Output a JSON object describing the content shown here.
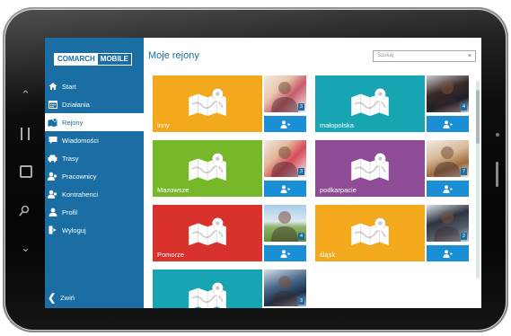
{
  "app": {
    "logo_part1": "COMARCH",
    "logo_part2": "MOBILE",
    "page_title": "Moje rejony",
    "search_placeholder": "Szukaj"
  },
  "sidebar": {
    "items": [
      {
        "label": "Start",
        "icon": "home-icon"
      },
      {
        "label": "Działania",
        "icon": "calendar-icon"
      },
      {
        "label": "Rejony",
        "icon": "regions-icon",
        "active": true
      },
      {
        "label": "Wiadomości",
        "icon": "message-icon"
      },
      {
        "label": "Trasy",
        "icon": "car-icon"
      },
      {
        "label": "Pracownicy",
        "icon": "employees-icon"
      },
      {
        "label": "Kontrahenci",
        "icon": "contractors-icon"
      },
      {
        "label": "Profil",
        "icon": "user-icon"
      },
      {
        "label": "Wyloguj",
        "icon": "logout-icon"
      }
    ],
    "collapse_label": "Zwiń"
  },
  "regions": [
    {
      "name": "inny",
      "count": "3",
      "color": "#f4a81c"
    },
    {
      "name": "małopolska",
      "count": "4",
      "color": "#17a5b4"
    },
    {
      "name": "Mazowsze",
      "count": "3",
      "color": "#76b82a"
    },
    {
      "name": "podkarpacie",
      "count": "7",
      "color": "#8e4b96"
    },
    {
      "name": "Pomorze",
      "count": "4",
      "color": "#d9312b"
    },
    {
      "name": "śląsk",
      "count": "2",
      "color": "#f4a81c"
    },
    {
      "name": "",
      "count": "3",
      "color": "#17a5b4"
    }
  ],
  "colors": {
    "sidebar": "#1b6ea3",
    "accent": "#1a8fd6"
  }
}
